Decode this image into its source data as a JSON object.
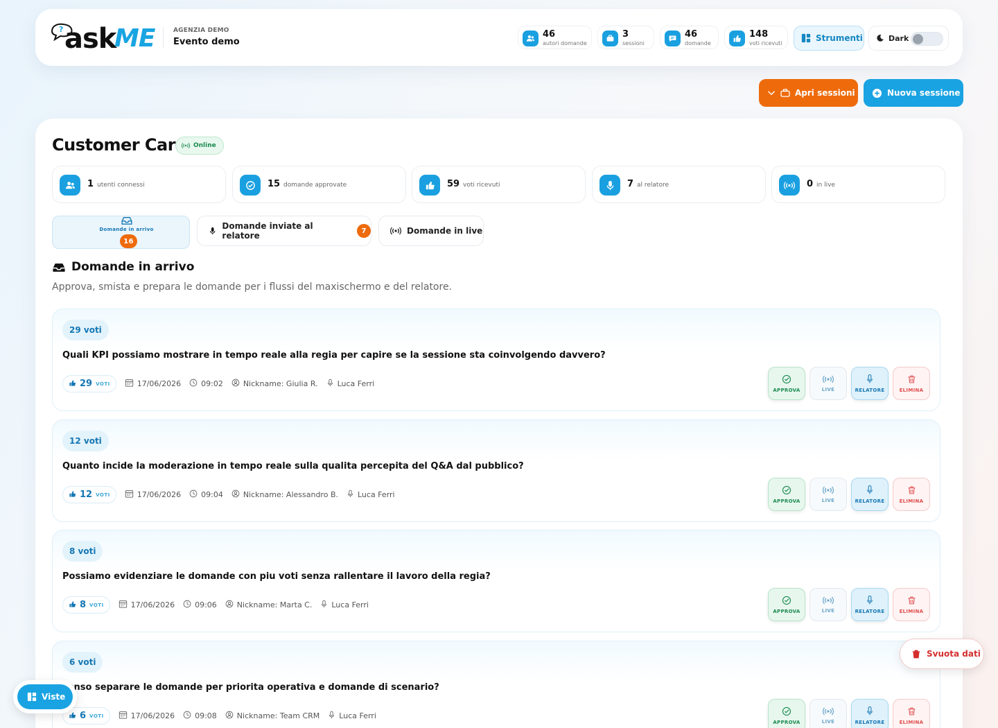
{
  "header": {
    "logo_ask": "ask",
    "logo_me": "ME",
    "logo_q": "?",
    "agency": "AGENZIA DEMO",
    "event": "Evento demo",
    "stats": [
      {
        "num": "46",
        "label": "autori domande",
        "icon": "users-icon"
      },
      {
        "num": "3",
        "label": "sessioni",
        "icon": "briefcase-icon"
      },
      {
        "num": "46",
        "label": "domande",
        "icon": "chat-icon"
      },
      {
        "num": "148",
        "label": "voti ricevuti",
        "icon": "thumbs-up-icon"
      }
    ],
    "tools_label": "Strumenti",
    "dark_label": "Dark"
  },
  "actions": {
    "open_sessions": "Apri sessioni",
    "new_session": "Nuova sessione"
  },
  "session": {
    "title": "Customer Care",
    "status": "Online",
    "kpis": [
      {
        "num": "1",
        "label": "utenti connessi"
      },
      {
        "num": "15",
        "label": "domande approvate"
      },
      {
        "num": "59",
        "label": "voti ricevuti"
      },
      {
        "num": "7",
        "label": "al relatore"
      },
      {
        "num": "0",
        "label": "in live"
      }
    ],
    "tabs": [
      {
        "label": "Domande in arrivo",
        "badge": "16"
      },
      {
        "label": "Domande inviate al relatore",
        "badge": "7"
      },
      {
        "label": "Domande in live"
      }
    ],
    "section_title": "Domande in arrivo",
    "section_sub": "Approva, smista e prepara le domande per i flussi del maxischermo e del relatore."
  },
  "questions": [
    {
      "votes_pill": "29 voti",
      "text": "Quali KPI possiamo mostrare in tempo reale alla regia per capire se la sessione sta coinvolgendo davvero?",
      "votes": "29",
      "date": "17/06/2026",
      "time": "09:02",
      "nickname": "Nickname: Giulia R.",
      "speaker": "Luca Ferri"
    },
    {
      "votes_pill": "12 voti",
      "text": "Quanto incide la moderazione in tempo reale sulla qualita percepita del Q&A dal pubblico?",
      "votes": "12",
      "date": "17/06/2026",
      "time": "09:04",
      "nickname": "Nickname: Alessandro B.",
      "speaker": "Luca Ferri"
    },
    {
      "votes_pill": "8 voti",
      "text": "Possiamo evidenziare le domande con piu voti senza rallentare il lavoro della regia?",
      "votes": "8",
      "date": "17/06/2026",
      "time": "09:06",
      "nickname": "Nickname: Marta C.",
      "speaker": "Luca Ferri"
    },
    {
      "votes_pill": "6 voti",
      "text": "senso separare le domande per priorita operativa e domande di scenario?",
      "votes": "6",
      "date": "17/06/2026",
      "time": "09:08",
      "nickname": "Nickname: Team CRM",
      "speaker": "Luca Ferri"
    }
  ],
  "labels": {
    "votes_unit": "VOTI",
    "approve": "APPROVA",
    "live": "LIVE",
    "speaker": "RELATORE",
    "delete": "ELIMINA"
  },
  "floating": {
    "clear_data": "Svuota dati",
    "views": "Viste"
  },
  "colors": {
    "accent": "#1aa3e2",
    "orange": "#ee6b0c",
    "green": "#1b8a4f",
    "red": "#df4d4d"
  }
}
